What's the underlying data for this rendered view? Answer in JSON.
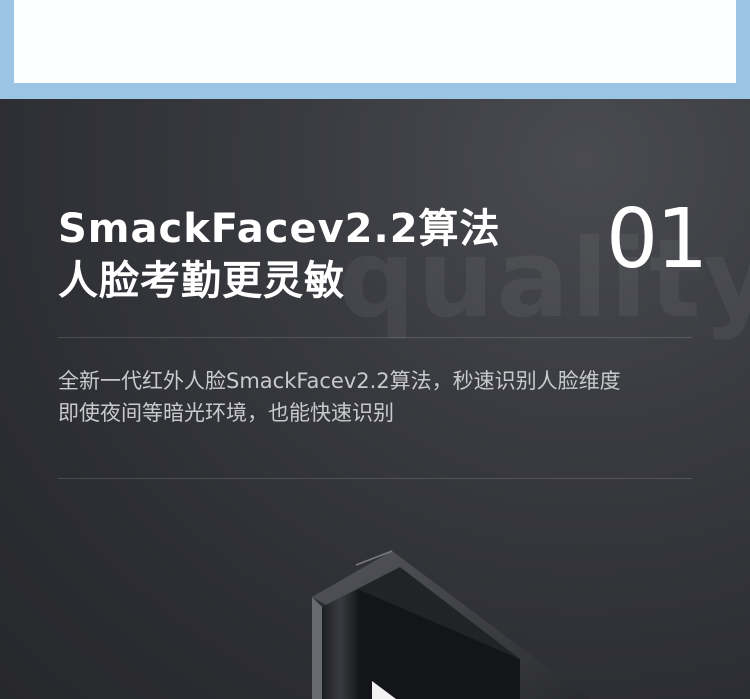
{
  "header_card": {},
  "feature": {
    "title_line1": "SmackFacev2.2算法",
    "title_line2": "人脸考勤更灵敏",
    "number": "01",
    "watermark": "quality",
    "desc_line1": "全新一代红外人脸SmackFacev2.2算法，秒速识别人脸维度",
    "desc_line2": "即使夜间等暗光环境，也能快速识别"
  },
  "colors": {
    "top_band": "#9cc4e4",
    "panel": "#2f3035",
    "title": "#ffffff",
    "desc": "#c9cacd"
  }
}
